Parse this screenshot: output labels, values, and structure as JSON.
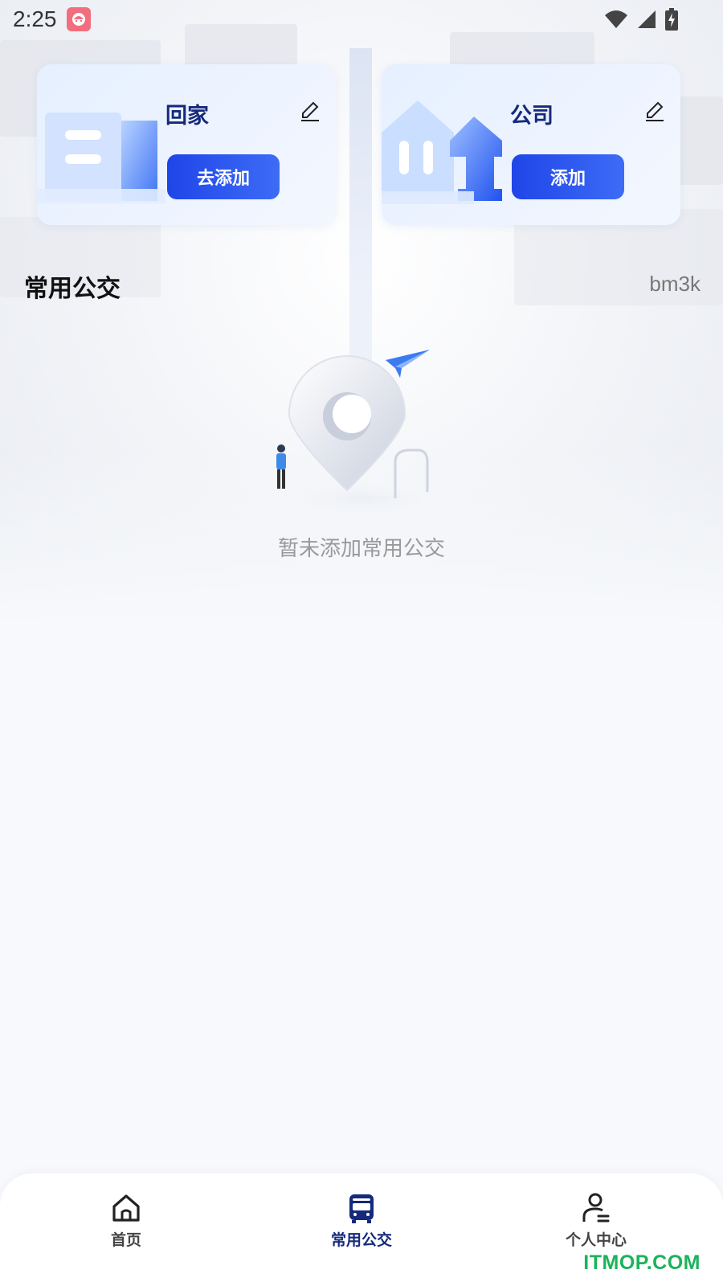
{
  "status_bar": {
    "time": "2:25"
  },
  "cards": {
    "home": {
      "title": "回家",
      "button": "去添加"
    },
    "company": {
      "title": "公司",
      "button": "添加"
    }
  },
  "section": {
    "title": "常用公交",
    "right_text": "bm3k"
  },
  "empty_state": {
    "message": "暂未添加常用公交"
  },
  "bottom_nav": {
    "items": [
      {
        "label": "首页",
        "icon": "home-icon",
        "active": false
      },
      {
        "label": "常用公交",
        "icon": "bus-icon",
        "active": true
      },
      {
        "label": "个人中心",
        "icon": "user-icon",
        "active": false
      }
    ]
  },
  "watermark": "ITMOP.COM",
  "colors": {
    "primary": "#1f45e8",
    "title_navy": "#152a7a",
    "muted": "#999999",
    "watermark": "#1bb35a"
  }
}
